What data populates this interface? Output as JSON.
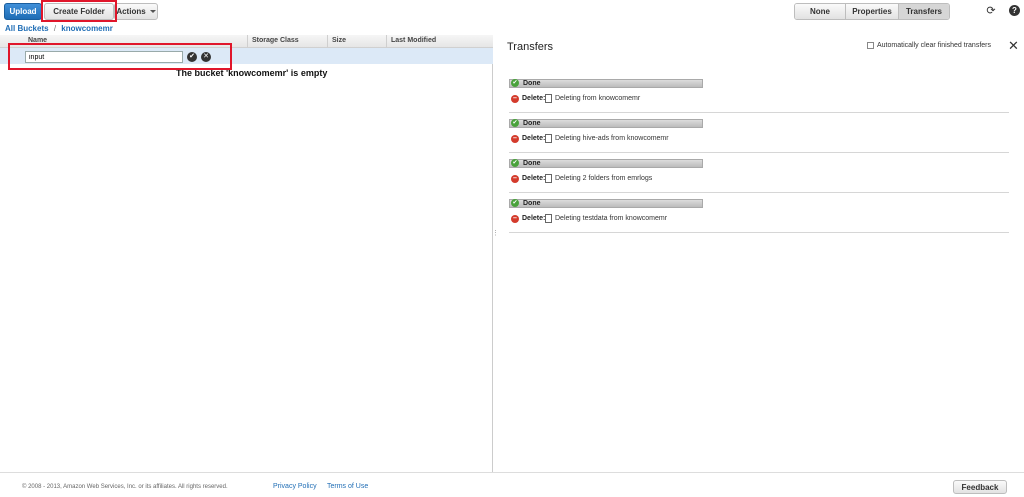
{
  "toolbar": {
    "upload_label": "Upload",
    "create_folder_label": "Create Folder",
    "actions_label": "Actions",
    "view_none": "None",
    "view_properties": "Properties",
    "view_transfers": "Transfers"
  },
  "breadcrumb": {
    "root": "All Buckets",
    "separator": "/",
    "bucket": "knowcomemr"
  },
  "table": {
    "columns": [
      "Name",
      "Storage Class",
      "Size",
      "Last Modified"
    ],
    "new_folder_value": "input",
    "empty_message": "The bucket 'knowcomemr' is empty"
  },
  "transfers": {
    "title": "Transfers",
    "auto_clear_label": "Automatically clear finished transfers",
    "items": [
      {
        "status": "Done",
        "action": "Delete:",
        "text": "Deleting from knowcomemr"
      },
      {
        "status": "Done",
        "action": "Delete:",
        "text": "Deleting hive-ads from knowcomemr"
      },
      {
        "status": "Done",
        "action": "Delete:",
        "text": "Deleting 2 folders from emrlogs"
      },
      {
        "status": "Done",
        "action": "Delete:",
        "text": "Deleting testdata from knowcomemr"
      }
    ]
  },
  "footer": {
    "copyright": "© 2008 - 2013, Amazon Web Services, Inc. or its affiliates. All rights reserved.",
    "privacy": "Privacy Policy",
    "terms": "Terms of Use",
    "feedback": "Feedback"
  },
  "colors": {
    "accent": "#1f6db5",
    "highlight_box": "#e0162b",
    "done": "#4aa33c",
    "delete": "#d43b2c"
  }
}
